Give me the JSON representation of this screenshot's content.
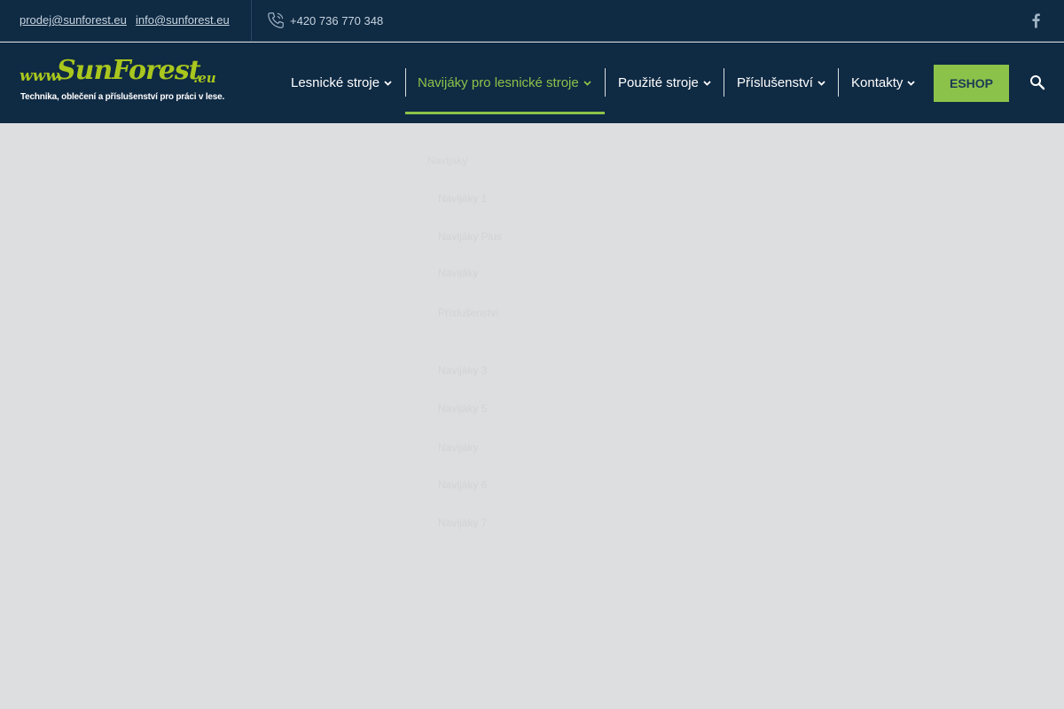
{
  "topbar": {
    "email_sales": "prodej@sunforest.eu",
    "email_info": "info@sunforest.eu",
    "phone": "+420 736 770 348",
    "icons": {
      "phone": "phone-icon",
      "social": "facebook-icon"
    }
  },
  "logo": {
    "www": "www.",
    "brand": "SunForest",
    "tld": ".eu",
    "tagline": "Technika, oblečení a příslušenství pro práci v lese."
  },
  "nav": {
    "items": [
      {
        "label": "Lesnické stroje",
        "active": false
      },
      {
        "label": "Navijáky pro lesnické stroje",
        "active": true
      },
      {
        "label": "Použité stroje",
        "active": false
      },
      {
        "label": "Příslušenství",
        "active": false
      },
      {
        "label": "Kontakty",
        "active": false
      }
    ],
    "eshop_label": "ESHOP",
    "search_icon": "search-icon"
  },
  "dropdown": {
    "heading": "Navijáky",
    "items": [
      "Navijáky 1",
      "Navijáky Plus",
      "Navijáky",
      "Příslušenství",
      "Navijáky 3",
      "Navijáky 5",
      "Navijáky",
      "Navijáky 6",
      "Navijáky 7"
    ]
  },
  "colors": {
    "header_bg": "#0f2a43",
    "accent_green": "#8bc34a",
    "logo_green": "#a9c71d",
    "page_bg": "#dddee0"
  }
}
